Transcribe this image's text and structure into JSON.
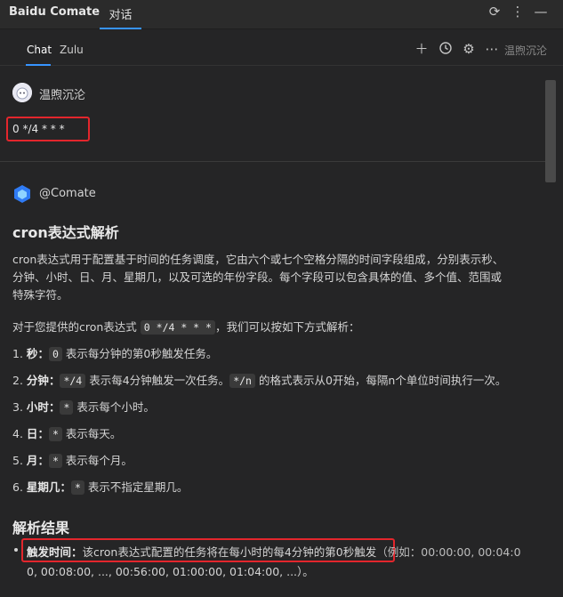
{
  "header": {
    "app_title": "Baidu Comate",
    "view_tab": "对话",
    "icons": [
      "sync-icon",
      "more-vertical-icon",
      "minimize-icon"
    ]
  },
  "subheader": {
    "tabs": [
      "Chat",
      "Zulu"
    ],
    "active_tab": "Chat",
    "icons": [
      "plus-icon",
      "history-icon",
      "settings-icon",
      "more-horizontal-icon"
    ],
    "user_name": "温煦沉沦"
  },
  "user_message": {
    "name": "温煦沉沦",
    "text": "0 */4 * * *"
  },
  "reply": {
    "author": "@Comate",
    "heading": "cron表达式解析",
    "intro_lines": [
      "cron表达式用于配置基于时间的任务调度，它由六个或七个空格分隔的时间字段组成，分别表示秒、",
      "分钟、小时、日、月、星期几，以及可选的年份字段。每个字段可以包含具体的值、多个值、范围或",
      "特殊字符。"
    ],
    "lead_prefix": "对于您提供的cron表达式",
    "lead_code": "0 */4 * * *",
    "lead_suffix": "，我们可以按如下方式解析：",
    "items": [
      {
        "num": "1.",
        "label": "秒",
        "code": "0",
        "desc": "表示每分钟的第0秒触发任务。"
      },
      {
        "num": "2.",
        "label": "分钟",
        "code": "*/4",
        "desc": "表示每4分钟触发一次任务。",
        "code2": "*/n",
        "desc2": "的格式表示从0开始，每隔n个单位时间执行一次。"
      },
      {
        "num": "3.",
        "label": "小时",
        "code": "*",
        "desc": "表示每个小时。"
      },
      {
        "num": "4.",
        "label": "日",
        "code": "*",
        "desc": "表示每天。"
      },
      {
        "num": "5.",
        "label": "月",
        "code": "*",
        "desc": "表示每个月。"
      },
      {
        "num": "6.",
        "label": "星期几",
        "code": "*",
        "desc": "表示不指定星期几。"
      }
    ],
    "result_heading": "解析结果",
    "result": {
      "label": "触发时间",
      "highlighted": "该cron表达式配置的任务将在每小时的每4分钟的第0秒触发",
      "rest_line1": "（例如：00:00:00, 00:04:0",
      "line2": "0, 00:08:00, ..., 00:56:00, 01:00:00, 01:04:00, ...）。"
    }
  },
  "colors": {
    "background": "#252526",
    "accent": "#3794ff",
    "highlight_box": "#e3262c"
  }
}
